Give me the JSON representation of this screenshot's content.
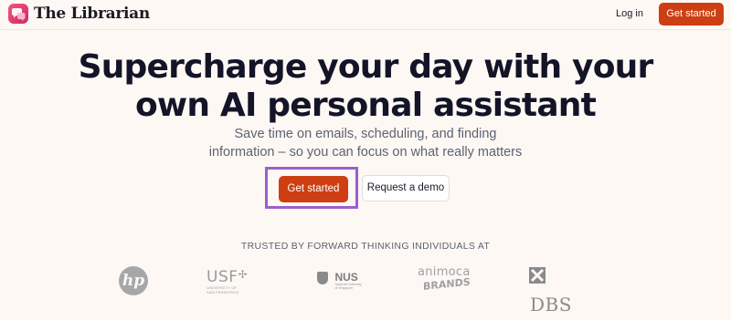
{
  "brand": {
    "name": "The Librarian",
    "logo_icon": "chat-bubbles-icon",
    "logo_color": "#e23a74"
  },
  "nav": {
    "login_label": "Log in",
    "cta_label": "Get started"
  },
  "hero": {
    "title_line1": "Supercharge your day with your",
    "title_line2": "own AI personal assistant",
    "subtitle_line1": "Save time on emails, scheduling, and finding",
    "subtitle_line2": "information – so you can focus on what really matters",
    "primary_cta": "Get started",
    "secondary_cta": "Request a demo"
  },
  "trusted": {
    "heading": "TRUSTED BY FORWARD THINKING INDIVIDUALS AT",
    "logos": [
      {
        "name": "hp",
        "mark": "hp"
      },
      {
        "name": "usf",
        "mark": "USF",
        "small_line1": "UNIVERSITY OF",
        "small_line2": "SAN FRANCISCO"
      },
      {
        "name": "nus",
        "mark": "NUS",
        "small_line1": "National University",
        "small_line2": "of Singapore"
      },
      {
        "name": "animoca-brands",
        "mark_top": "animoca",
        "mark_bottom": "BRANDS"
      },
      {
        "name": "dbs",
        "mark": "DBS"
      }
    ]
  },
  "colors": {
    "accent": "#cd3f12",
    "background": "#fdf8f3",
    "highlight_outline": "#9b5fd1"
  }
}
